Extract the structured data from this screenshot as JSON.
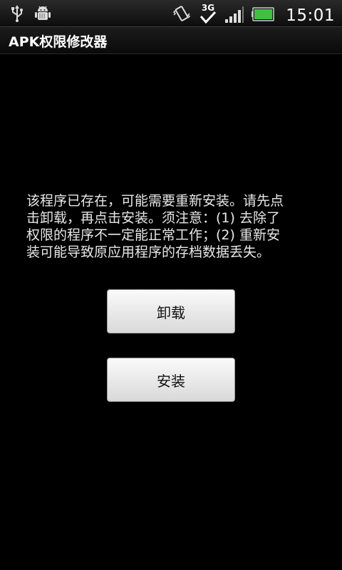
{
  "status_bar": {
    "time": "15:01",
    "network_type": "3G",
    "icons_left": [
      "usb-icon",
      "android-debug-icon"
    ],
    "icons_right": [
      "vibrate-icon",
      "network-3g-icon",
      "signal-icon",
      "battery-icon"
    ],
    "battery_color": "#3fc13f"
  },
  "app": {
    "title": "APK权限修改器"
  },
  "dialog": {
    "message": "该程序已存在，可能需要重新安装。请先点\n击卸载，再点击安装。须注意：(1) 去除了\n权限的程序不一定能正常工作；(2) 重新安\n装可能导致原应用程序的存档数据丢失。",
    "uninstall_label": "卸载",
    "install_label": "安装"
  }
}
